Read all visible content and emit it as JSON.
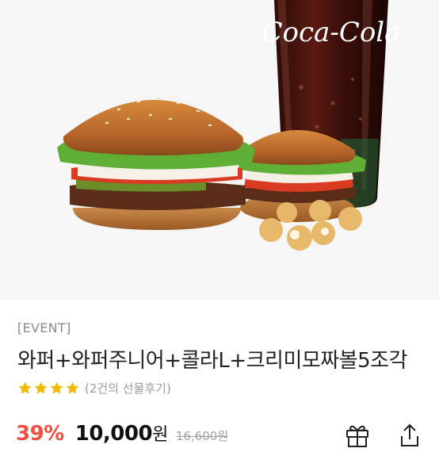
{
  "product": {
    "tag": "[EVENT]",
    "name": "와퍼+와퍼주니어+콜라L+크리미모짜볼5조각",
    "image_text": "Coca-Cola"
  },
  "rating": {
    "stars": 4,
    "max_stars": 4,
    "review_text": "(2건의 선물후기)"
  },
  "price": {
    "discount": "39%",
    "sale_amount": "10,000",
    "sale_unit": "원",
    "original": "16,600원"
  },
  "icons": {
    "gift": "gift-icon",
    "share": "share-icon",
    "star": "star-icon"
  },
  "colors": {
    "discount": "#f24e3e",
    "star": "#f5b800",
    "text": "#222222",
    "muted": "#9a9a9a"
  }
}
